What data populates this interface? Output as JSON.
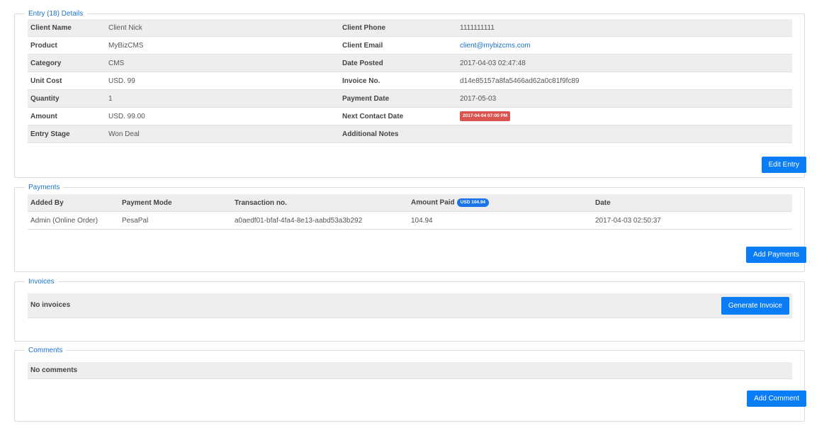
{
  "entry": {
    "legend": "Entry (18) Details",
    "rows": [
      {
        "l1": "Client Name",
        "v1": "Client Nick",
        "l2": "Client Phone",
        "v2": "1111111111"
      },
      {
        "l1": "Product",
        "v1": "MyBizCMS",
        "l2": "Client Email",
        "v2": "client@mybizcms.com"
      },
      {
        "l1": "Category",
        "v1": "CMS",
        "l2": "Date Posted",
        "v2": "2017-04-03 02:47:48"
      },
      {
        "l1": "Unit Cost",
        "v1": "USD. 99",
        "l2": "Invoice No.",
        "v2": "d14e85157a8fa5466ad62a0c81f9fc89"
      },
      {
        "l1": "Quantity",
        "v1": "1",
        "l2": "Payment Date",
        "v2": "2017-05-03"
      },
      {
        "l1": "Amount",
        "v1": "USD. 99.00",
        "l2": "Next Contact Date",
        "v2": "2017-04-04 07:00 PM"
      },
      {
        "l1": "Entry Stage",
        "v1": "Won Deal",
        "l2": "Additional Notes",
        "v2": ""
      }
    ],
    "edit_button": "Edit Entry",
    "colors": {
      "link": "#1a73c8",
      "badge": "#d9534f",
      "button": "#0a7cf5"
    }
  },
  "payments": {
    "legend": "Payments",
    "headers": {
      "added_by": "Added By",
      "mode": "Payment Mode",
      "txn": "Transaction no.",
      "amount": "Amount Paid",
      "amount_badge": "USD 104.94",
      "date": "Date"
    },
    "row": {
      "added_by": "Admin (Online Order)",
      "mode": "PesaPal",
      "txn": "a0aedf01-bfaf-4fa4-8e13-aabd53a3b292",
      "amount": "104.94",
      "date": "2017-04-03 02:50:37"
    },
    "add_button": "Add Payments"
  },
  "invoices": {
    "legend": "Invoices",
    "empty": "No invoices",
    "generate_button": "Generate Invoice"
  },
  "comments": {
    "legend": "Comments",
    "empty": "No comments",
    "add_button": "Add Comment"
  }
}
